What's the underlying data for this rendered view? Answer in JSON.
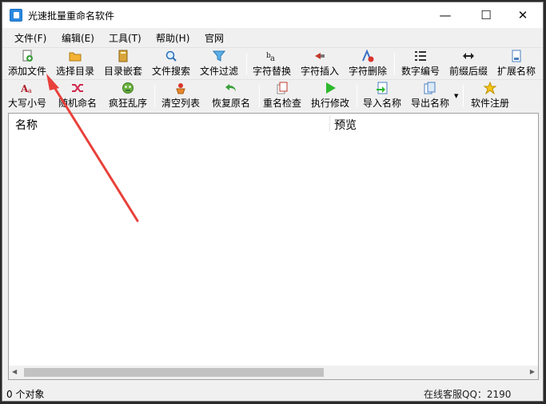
{
  "window": {
    "title": "光速批量重命名软件",
    "minimize_glyph": "—",
    "maximize_glyph": "☐",
    "close_glyph": "✕"
  },
  "menu": [
    "文件(F)",
    "编辑(E)",
    "工具(T)",
    "帮助(H)",
    "官网"
  ],
  "toolbar_row1": [
    {
      "label": "添加文件",
      "icon": "add-file-icon"
    },
    {
      "label": "选择目录",
      "icon": "folder-icon"
    },
    {
      "label": "目录嵌套",
      "icon": "nested-folder-icon"
    },
    {
      "label": "文件搜索",
      "icon": "magnifier-icon"
    },
    {
      "label": "文件过滤",
      "icon": "funnel-icon"
    },
    {
      "label": "字符替换",
      "icon": "replace-chars-icon"
    },
    {
      "label": "字符插入",
      "icon": "insert-chars-icon"
    },
    {
      "label": "字符删除",
      "icon": "delete-chars-icon"
    },
    {
      "label": "数字编号",
      "icon": "numbered-list-icon"
    },
    {
      "label": "前缀后缀",
      "icon": "prefix-suffix-icon"
    },
    {
      "label": "扩展名称",
      "icon": "extension-icon"
    }
  ],
  "toolbar_row2": [
    {
      "label": "大写小号",
      "icon": "case-icon"
    },
    {
      "label": "随机命名",
      "icon": "shuffle-icon"
    },
    {
      "label": "疯狂乱序",
      "icon": "crazy-face-icon"
    },
    {
      "label": "清空列表",
      "icon": "clear-list-icon"
    },
    {
      "label": "恢复原名",
      "icon": "undo-icon"
    },
    {
      "label": "重名检查",
      "icon": "duplicate-check-icon"
    },
    {
      "label": "执行修改",
      "icon": "play-icon"
    },
    {
      "label": "导入名称",
      "icon": "import-icon"
    },
    {
      "label": "导出名称",
      "icon": "export-icon"
    },
    {
      "label": "软件注册",
      "icon": "star-icon"
    }
  ],
  "list": {
    "columns": [
      "名称",
      "预览"
    ],
    "rows": []
  },
  "status": {
    "object_count": "0 个对象",
    "right_text": "在线客服QQ：2190"
  },
  "colors": {
    "arrow": "#e8413b",
    "window_bg": "#f0f0f0",
    "outer_bg": "#2b2b2b"
  }
}
